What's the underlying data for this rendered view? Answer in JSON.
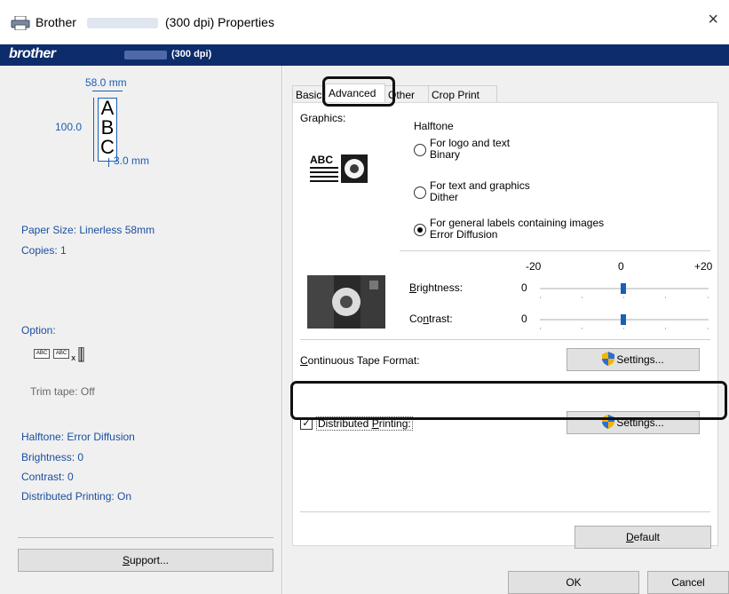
{
  "window": {
    "title_brand": "Brother",
    "title_suffix": "(300 dpi) Properties",
    "close_glyph": "×"
  },
  "brand_bar": {
    "logo": "brother",
    "dpi": "(300 dpi)"
  },
  "preview": {
    "width_dim": "58.0 mm",
    "height_dim": "100.0",
    "margin_dim": "3.0 mm",
    "letters": [
      "A",
      "B",
      "C"
    ]
  },
  "summary": {
    "paper_size": "Paper Size: Linerless 58mm",
    "copies": "Copies: 1",
    "option_label": "Option:",
    "option_icons": [
      "ABC",
      "ABC"
    ],
    "trim_tape": "Trim tape: Off",
    "halftone": "Halftone: Error Diffusion",
    "brightness": "Brightness:  0",
    "contrast": "Contrast:  0",
    "distributed": "Distributed Printing: On"
  },
  "buttons": {
    "support": "Support...",
    "default": "Default",
    "ok": "OK",
    "cancel": "Cancel",
    "settings": "Settings..."
  },
  "tabs": [
    "Basic",
    "Advanced",
    "Other",
    "Crop Print"
  ],
  "active_tab": "Advanced",
  "graphics": {
    "label": "Graphics:",
    "halftone_label": "Halftone",
    "abc_icon_text": "ABC",
    "options": [
      {
        "line1": "For logo and text",
        "line2": "Binary",
        "checked": false
      },
      {
        "line1": "For text and graphics",
        "line2": "Dither",
        "checked": false
      },
      {
        "line1": "For general labels containing images",
        "line2": "Error Diffusion",
        "checked": true
      }
    ]
  },
  "adjust": {
    "scale": [
      "-20",
      "0",
      "+20"
    ],
    "brightness_label": "Brightness:",
    "brightness_value": "0",
    "brightness_level": 0,
    "contrast_label": "Contrast:",
    "contrast_value": "0",
    "contrast_level": 0
  },
  "continuous_tape": {
    "label": "Continuous Tape Format:"
  },
  "distributed_printing": {
    "label": "Distributed Printing:",
    "checked": true,
    "check_glyph": "✓"
  },
  "colors": {
    "brand_bar": "#0d2c6c",
    "summary_text": "#1a4fa0",
    "slider_thumb": "#1a5fb4",
    "highlight": "#111111"
  }
}
